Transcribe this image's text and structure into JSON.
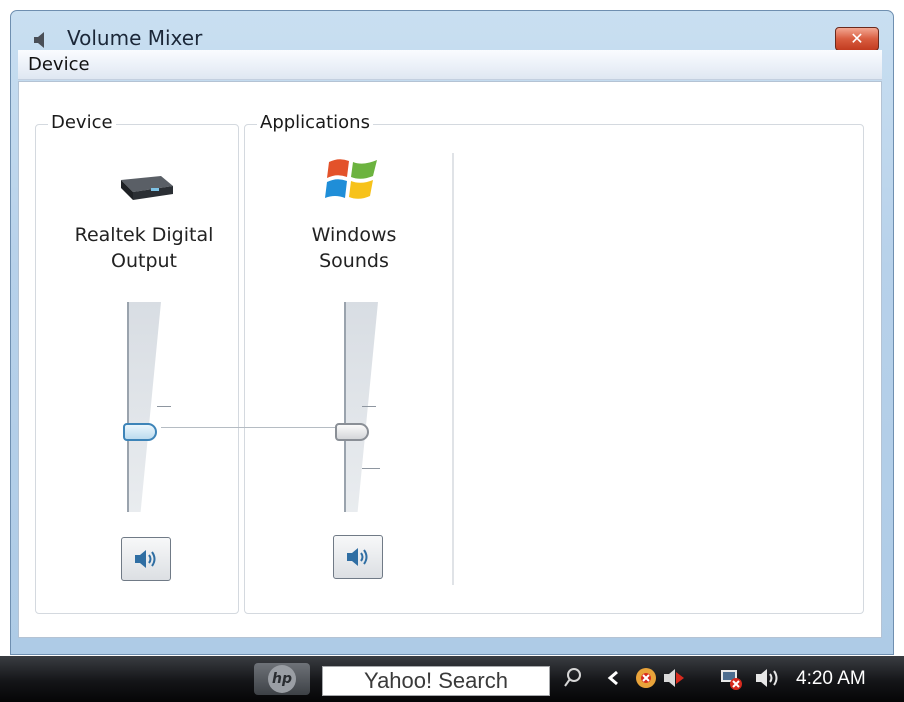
{
  "window": {
    "title": "Volume Mixer",
    "close_label": "✕"
  },
  "menubar": {
    "device_label": "Device"
  },
  "device_group": {
    "legend": "Device",
    "name_line1": "Realtek Digital",
    "name_line2": "Output",
    "volume": 0.38,
    "muted": false
  },
  "applications_group": {
    "legend": "Applications",
    "apps": [
      {
        "name_line1": "Windows",
        "name_line2": "Sounds",
        "volume": 0.38,
        "muted": false
      }
    ]
  },
  "taskbar": {
    "search_placeholder": "Yahoo! Search",
    "clock": "4:20 AM"
  },
  "colors": {
    "accent": "#3d84b8",
    "close": "#c23b20",
    "taskbar": "#141518"
  }
}
